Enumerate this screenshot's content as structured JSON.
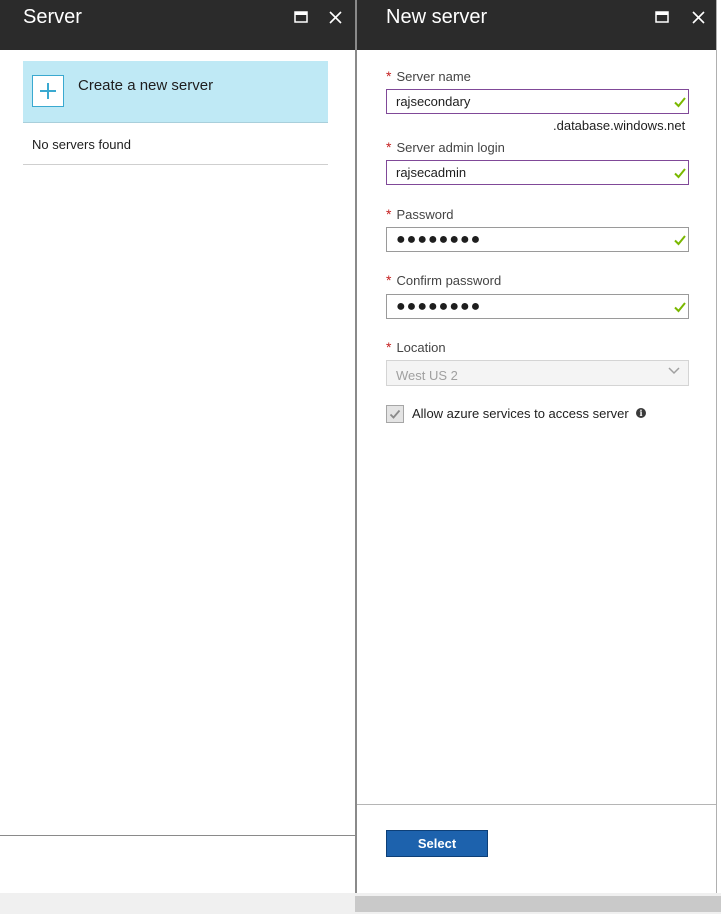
{
  "left_blade": {
    "title": "Server",
    "create_label": "Create a new server",
    "empty_text": "No servers found"
  },
  "right_blade": {
    "title": "New server",
    "fields": {
      "server_name": {
        "label": "Server name",
        "value": "rajsecondary",
        "suffix": ".database.windows.net",
        "required_mark": "*"
      },
      "admin_login": {
        "label": "Server admin login",
        "value": "rajsecadmin",
        "required_mark": "*"
      },
      "password": {
        "label": "Password",
        "value": "●●●●●●●●",
        "required_mark": "*"
      },
      "confirm_password": {
        "label": "Confirm password",
        "value": "●●●●●●●●",
        "required_mark": "*"
      },
      "location": {
        "label": "Location",
        "value": "West US 2",
        "required_mark": "*"
      }
    },
    "allow_azure": {
      "label": "Allow azure services to access server",
      "checked": true,
      "info_glyph": "i"
    },
    "select_button": "Select"
  },
  "colors": {
    "header_bg": "#2b2b2b",
    "tile_bg": "#bfe9f5",
    "required": "#c41e1e",
    "focus_border": "#804998",
    "valid_check": "#7ab800",
    "primary_button": "#1d62ad"
  },
  "icons": {
    "maximize": "maximize-icon",
    "close": "close-icon",
    "plus": "plus-icon",
    "valid": "checkmark-icon",
    "dropdown": "chevron-down-icon",
    "info": "info-icon"
  }
}
